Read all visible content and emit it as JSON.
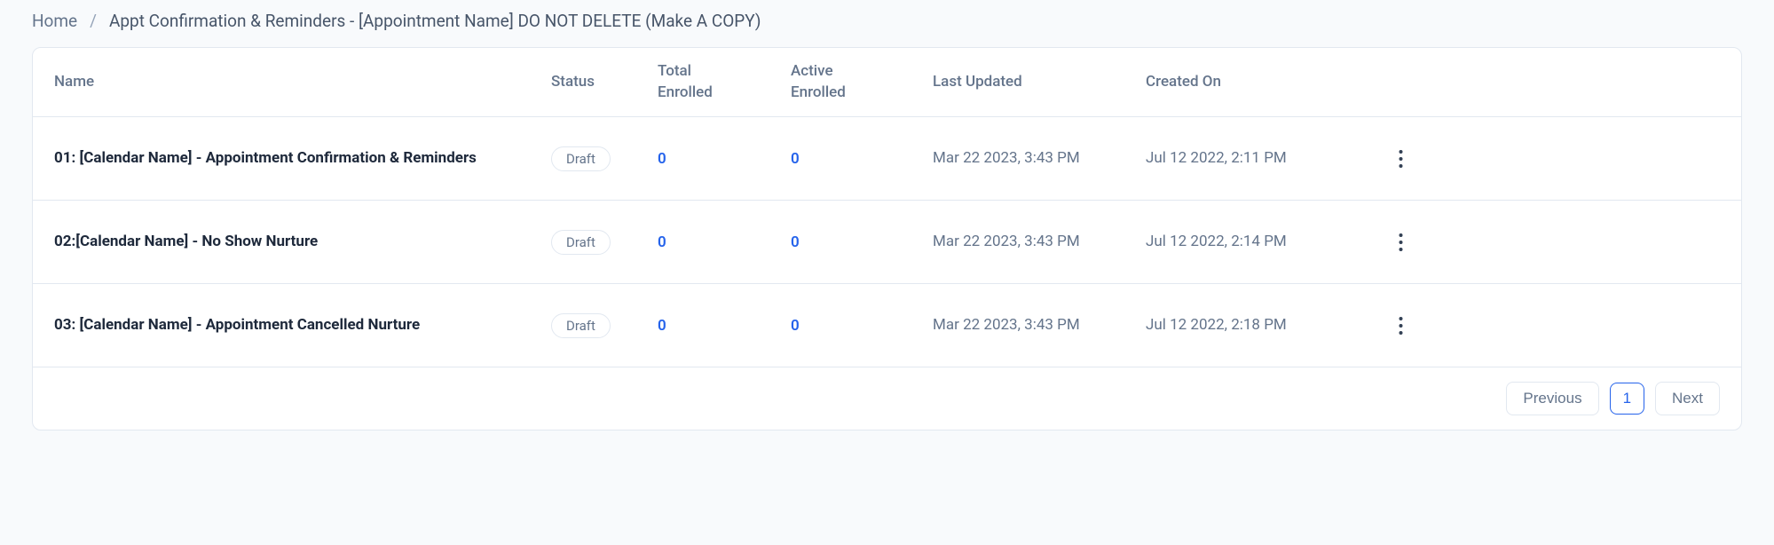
{
  "breadcrumb": {
    "home": "Home",
    "separator": "/",
    "current": "Appt Confirmation & Reminders - [Appointment Name] DO NOT DELETE (Make A COPY)"
  },
  "columns": {
    "name": "Name",
    "status": "Status",
    "total_enrolled_l1": "Total",
    "total_enrolled_l2": "Enrolled",
    "active_enrolled_l1": "Active",
    "active_enrolled_l2": "Enrolled",
    "last_updated": "Last Updated",
    "created_on": "Created On"
  },
  "rows": [
    {
      "name": "01: [Calendar Name] - Appointment Confirmation & Reminders",
      "status": "Draft",
      "total_enrolled": "0",
      "active_enrolled": "0",
      "last_updated": "Mar 22 2023, 3:43 PM",
      "created_on": "Jul 12 2022, 2:11 PM"
    },
    {
      "name": "02:[Calendar Name] - No Show Nurture",
      "status": "Draft",
      "total_enrolled": "0",
      "active_enrolled": "0",
      "last_updated": "Mar 22 2023, 3:43 PM",
      "created_on": "Jul 12 2022, 2:14 PM"
    },
    {
      "name": "03: [Calendar Name] - Appointment Cancelled Nurture",
      "status": "Draft",
      "total_enrolled": "0",
      "active_enrolled": "0",
      "last_updated": "Mar 22 2023, 3:43 PM",
      "created_on": "Jul 12 2022, 2:18 PM"
    }
  ],
  "pagination": {
    "previous": "Previous",
    "page": "1",
    "next": "Next"
  }
}
